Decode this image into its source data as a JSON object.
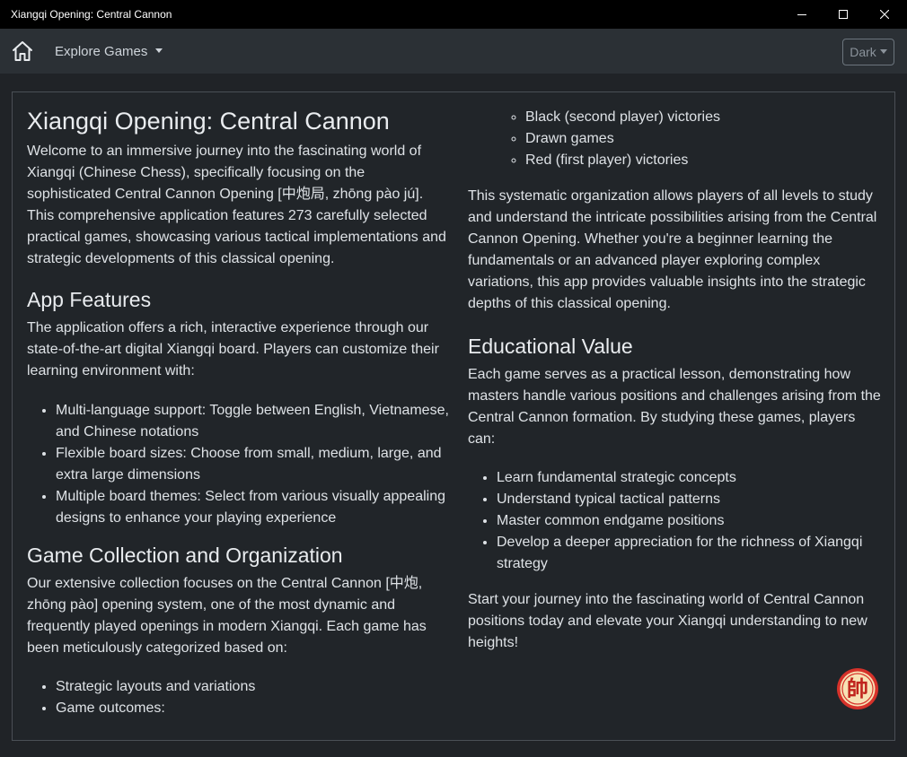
{
  "window": {
    "title": "Xiangqi Opening: Central Cannon"
  },
  "navbar": {
    "explore_label": "Explore Games",
    "theme_label": "Dark"
  },
  "content": {
    "title": "Xiangqi Opening: Central Cannon",
    "intro": "Welcome to an immersive journey into the fascinating world of Xiangqi (Chinese Chess), specifically focusing on the sophisticated Central Cannon Opening [中炮局, zhōng pào jú]. This comprehensive application features 273 carefully selected practical games, showcasing various tactical implementations and strategic developments of this classical opening.",
    "features_heading": "App Features",
    "features_text": "The application offers a rich, interactive experience through our state-of-the-art digital Xiangqi board. Players can customize their learning environment with:",
    "features": [
      "Multi-language support: Toggle between English, Vietnamese, and Chinese notations",
      "Flexible board sizes: Choose from small, medium, large, and extra large dimensions",
      "Multiple board themes: Select from various visually appealing designs to enhance your playing experience"
    ],
    "collection_heading": "Game Collection and Organization",
    "collection_text": "Our extensive collection focuses on the Central Cannon [中炮, zhōng pào] opening system, one of the most dynamic and frequently played openings in modern Xiangqi. Each game has been meticulously categorized based on:",
    "collection_items": [
      "Strategic layouts and variations",
      "Game outcomes:"
    ],
    "outcomes": [
      "Black (second player) victories",
      "Drawn games",
      "Red (first player) victories"
    ],
    "organization_text": "This systematic organization allows players of all levels to study and understand the intricate possibilities arising from the Central Cannon Opening. Whether you're a beginner learning the fundamentals or an advanced player exploring complex variations, this app provides valuable insights into the strategic depths of this classical opening.",
    "education_heading": "Educational Value",
    "education_text": "Each game serves as a practical lesson, demonstrating how masters handle various positions and challenges arising from the Central Cannon formation. By studying these games, players can:",
    "education_items": [
      "Learn fundamental strategic concepts",
      "Understand typical tactical patterns",
      "Master common endgame positions",
      "Develop a deeper appreciation for the richness of Xiangqi strategy"
    ],
    "closing": "Start your journey into the fascinating world of Central Cannon positions today and elevate your Xiangqi understanding to new heights!"
  },
  "badge": {
    "glyph": "帥",
    "icon": "xiangqi-general-piece-icon",
    "color": "#d6322a"
  },
  "colors": {
    "background": "#202327",
    "navbar": "#2b3035",
    "text": "#dee2e6"
  }
}
